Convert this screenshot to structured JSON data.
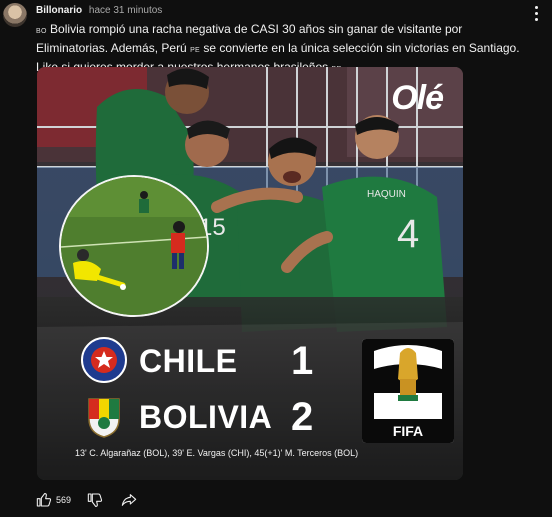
{
  "post": {
    "author": "Billonario",
    "time": "hace 31 minutos",
    "flag_bo": "BO",
    "text_1": " Bolivia rompió una racha negativa de CASI 30 años sin ganar de visitante por Eliminatorias. Además, Perú ",
    "flag_pe": "PE",
    "text_2": " se convierte en la única selección sin victorias en Santiago.  Like si quieres morder a nuestros hermanos brasileños ",
    "flag_br": "BR"
  },
  "image": {
    "logo": "Olé",
    "home_team": "CHILE",
    "home_score": "1",
    "away_team": "BOLIVIA",
    "away_score": "2",
    "emblem_label": "FIFA",
    "scorers": "13' C. Algarañaz (BOL), 39' E. Vargas (CHI), 45(+1)' M. Terceros (BOL)",
    "shirt_number_left": "15",
    "shirt_number_right": "4",
    "shirt_name_right": "HAQUIN",
    "colors": {
      "bolivia_green": "#1f6b3a",
      "chile_red": "#d52b1e",
      "field_green": "#4f7e2e"
    }
  },
  "actions": {
    "like_icon": "thumbs-up-icon",
    "like_count": "569",
    "dislike_icon": "thumbs-down-icon",
    "share_icon": "share-icon"
  }
}
